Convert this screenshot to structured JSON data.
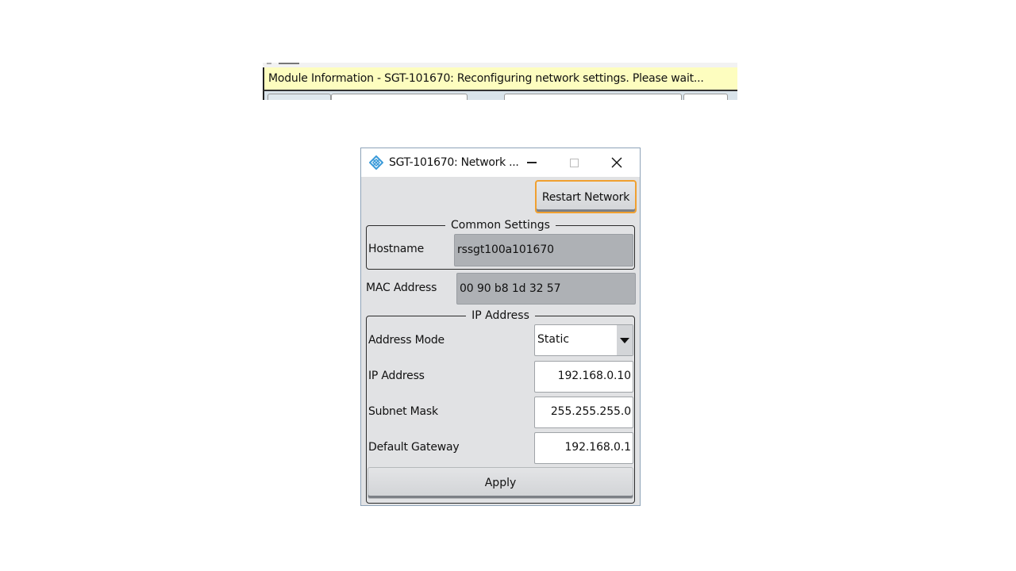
{
  "status_strip": {
    "message": "Module Information - SGT-101670: Reconfiguring network settings. Please wait..."
  },
  "dialog": {
    "app_icon": "rohde-schwarz-diamond-icon",
    "title": "SGT-101670: Network ...",
    "window_controls": {
      "minimize": "minimize-icon",
      "maximize": "maximize-icon",
      "close": "close-icon",
      "close_glyph": "✕"
    },
    "restart_button": "Restart Network",
    "common_settings": {
      "legend": "Common Settings",
      "hostname_label": "Hostname",
      "hostname_value": "rssgt100a101670"
    },
    "mac": {
      "label": "MAC Address",
      "value": "00 90 b8 1d 32 57"
    },
    "ip_address": {
      "legend": "IP Address",
      "address_mode_label": "Address Mode",
      "address_mode_value": "Static",
      "ip_label": "IP Address",
      "ip_value": "192.168.0.10",
      "subnet_label": "Subnet Mask",
      "subnet_value": "255.255.255.0",
      "gateway_label": "Default Gateway",
      "gateway_value": "192.168.0.1"
    },
    "apply_button": "Apply",
    "colors": {
      "focus_outline": "#f0a030",
      "status_bg": "#fdfdbf",
      "icon_blue": "#3a9ad9"
    }
  }
}
